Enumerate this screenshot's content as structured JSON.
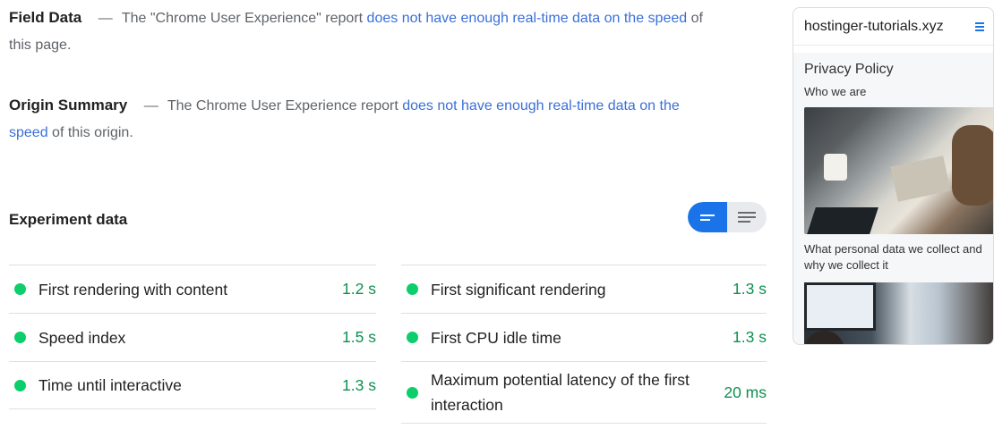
{
  "field_data": {
    "heading": "Field Data",
    "dash": "—",
    "text_before": "The \"Chrome User Experience\" report ",
    "link": "does not have enough real-time data on the speed",
    "text_after": " of this page."
  },
  "origin_summary": {
    "heading": "Origin Summary",
    "dash": "—",
    "text_before": "The Chrome User Experience report ",
    "link": "does not have enough real-time data on the speed",
    "text_after": " of this origin."
  },
  "experiment": {
    "title": "Experiment data",
    "view_toggle": {
      "selected": "summary",
      "options": [
        "summary-view-icon",
        "list-view-icon"
      ]
    }
  },
  "metrics_left": [
    {
      "label": "First rendering with content",
      "value": "1.2 s"
    },
    {
      "label": "Speed index",
      "value": "1.5 s"
    },
    {
      "label": "Time until interactive",
      "value": "1.3 s"
    }
  ],
  "metrics_right": [
    {
      "label": "First significant rendering",
      "value": "1.3 s"
    },
    {
      "label": "First CPU idle time",
      "value": "1.3 s"
    },
    {
      "label": "Maximum potential latency of the first interaction",
      "value": "20 ms"
    }
  ],
  "preview": {
    "site_title": "hostinger-tutorials.xyz",
    "page_title": "Privacy Policy",
    "subheading": "Who we are",
    "paragraph": "What personal data we collect and why we collect it"
  },
  "colors": {
    "pass_dot": "#0cce6b",
    "pass_value": "#0d904f",
    "link": "#3b6fd8",
    "toggle_active": "#1a73e8"
  }
}
